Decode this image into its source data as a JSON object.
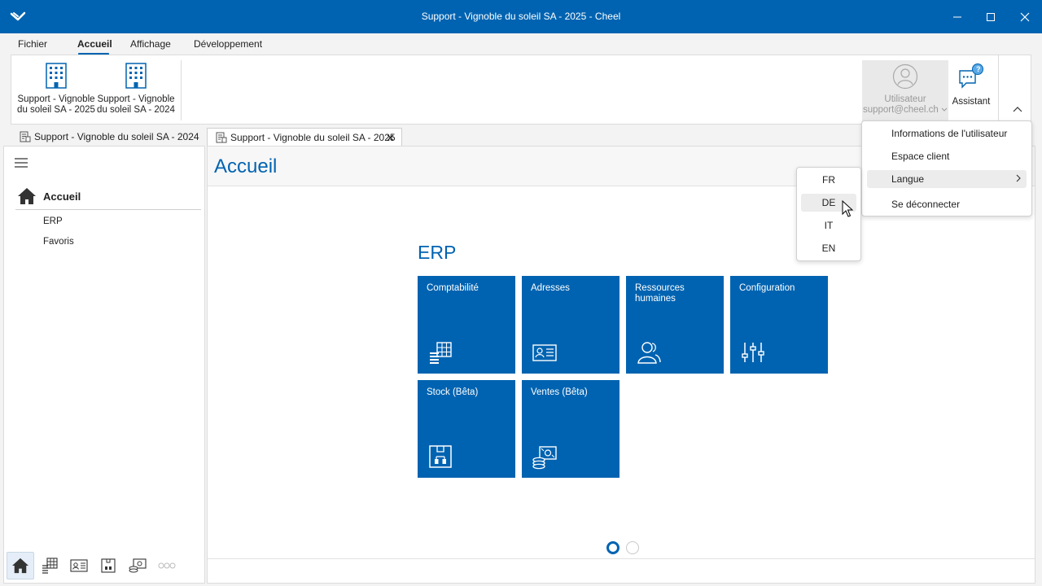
{
  "window": {
    "title": "Support - Vignoble du soleil SA - 2025 - Cheel"
  },
  "menubar": {
    "items": [
      {
        "label": "Fichier"
      },
      {
        "label": "Accueil"
      },
      {
        "label": "Affichage"
      },
      {
        "label": "Développement"
      }
    ],
    "active": "Accueil"
  },
  "ribbon": {
    "buttons": [
      {
        "label_line1": "Support - Vignoble",
        "label_line2": "du soleil SA - 2025",
        "icon": "building-icon"
      },
      {
        "label_line1": "Support - Vignoble",
        "label_line2": "du soleil SA - 2024",
        "icon": "building-icon"
      }
    ],
    "user": {
      "label": "Utilisateur",
      "email": "support@cheel.ch"
    },
    "assistant": {
      "label": "Assistant",
      "badge": "?"
    }
  },
  "doc_tabs": [
    {
      "label": "Support - Vignoble du soleil SA - 2024",
      "active": false
    },
    {
      "label": "Support - Vignoble du soleil SA - 2025",
      "active": true,
      "close": "✕"
    }
  ],
  "leftnav": {
    "home_label": "Accueil",
    "items": [
      {
        "label": "ERP"
      },
      {
        "label": "Favoris"
      }
    ]
  },
  "main": {
    "title": "Accueil",
    "section_title": "ERP",
    "tiles": [
      {
        "label": "Comptabilité",
        "icon": "accounting-icon"
      },
      {
        "label": "Adresses",
        "icon": "address-card-icon"
      },
      {
        "label": "Ressources humaines",
        "icon": "people-icon"
      },
      {
        "label": "Configuration",
        "icon": "sliders-icon"
      },
      {
        "label": "Stock (Bêta)",
        "icon": "box-icon"
      },
      {
        "label": "Ventes (Bêta)",
        "icon": "sales-icon"
      }
    ],
    "pager": {
      "pages": 2,
      "current": 1
    }
  },
  "user_menu": {
    "items": [
      {
        "label": "Informations de l'utilisateur"
      },
      {
        "label": "Espace client"
      },
      {
        "label": "Langue",
        "submenu": true
      },
      {
        "label": "Se déconnecter"
      }
    ]
  },
  "language_menu": {
    "items": [
      "FR",
      "DE",
      "IT",
      "EN"
    ],
    "hovered": "DE"
  },
  "colors": {
    "accent": "#0063b1",
    "tile": "#0063b1",
    "titlebar": "#0063b1"
  }
}
